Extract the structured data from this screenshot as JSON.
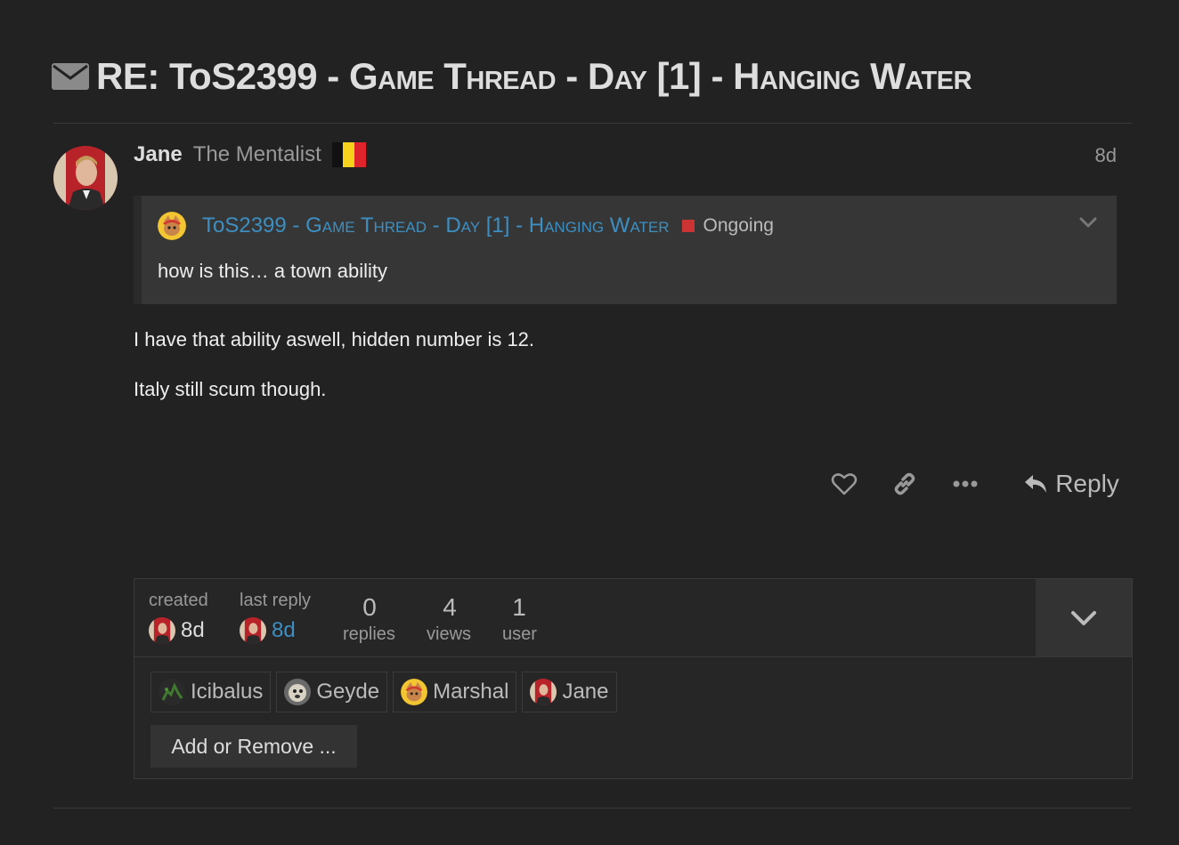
{
  "topic": {
    "title_prefix": "RE: ToS2399 - ",
    "title_smallcaps": "Game Thread - Day [1] - Hanging Water"
  },
  "post": {
    "username": "Jane",
    "user_title": "The Mentalist",
    "date": "8d",
    "quote": {
      "title_prefix": "ToS2399 - ",
      "title_smallcaps": "Game Thread - Day [1] - Hanging Water",
      "category": "Ongoing",
      "text": "how is this… a town ability"
    },
    "paragraphs": [
      "I have that ability aswell, hidden number is 12.",
      "Italy still scum though."
    ],
    "reply_label": "Reply"
  },
  "topic_map": {
    "created_label": "created",
    "created_ago": "8d",
    "last_reply_label": "last reply",
    "last_reply_ago": "8d",
    "replies_count": "0",
    "replies_label": "replies",
    "views_count": "4",
    "views_label": "views",
    "users_count": "1",
    "users_label": "user",
    "participants": [
      "Icibalus",
      "Geyde",
      "Marshal",
      "Jane"
    ],
    "add_remove_label": "Add or Remove ..."
  },
  "colors": {
    "background": "#222222",
    "link": "#3d8fc2",
    "category": "#cc3333"
  }
}
